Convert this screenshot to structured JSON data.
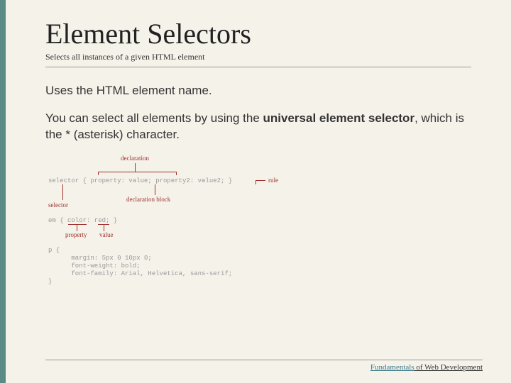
{
  "title": "Element Selectors",
  "subtitle": "Selects all instances of a given HTML element",
  "para1": "Uses the HTML element name.",
  "para2a": "You can select all elements by using the ",
  "para2b": "universal element selector",
  "para2c": ", which is the * (asterisk) character.",
  "diagram": {
    "declaration": "declaration",
    "syntax": "selector { property: value; property2: value2; }",
    "rule": "rule",
    "selector": "selector",
    "declaration_block": "declaration block",
    "example1": "em { color: red; }",
    "property": "property",
    "value": "value",
    "example2_line1": "p {",
    "example2_line2": "      margin: 5px 0 10px 0;",
    "example2_line3": "      font-weight: bold;",
    "example2_line4": "      font-family: Arial, Helvetica, sans-serif;",
    "example2_line5": "}"
  },
  "footer": {
    "accent": "Fundamentals",
    "rest": " of Web Development"
  }
}
